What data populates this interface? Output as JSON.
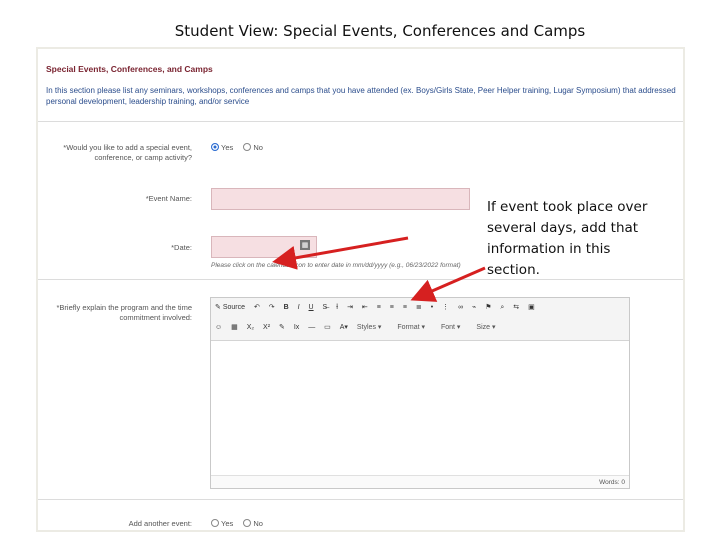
{
  "slide": {
    "title": "Student View: Special Events, Conferences and Camps",
    "annotation": "If event took place over several days, add that information in this section."
  },
  "form": {
    "section_title": "Special Events, Conferences, and Camps",
    "section_text": "In this section please list any seminars, workshops, conferences and camps that you have attended (ex. Boys/Girls State, Peer Helper training, Lugar Symposium) that addressed personal development, leadership training, and/or service",
    "add_event_label": "*Would you like to add a special event, conference, or camp activity?",
    "yes_label": "Yes",
    "no_label": "No",
    "event_name_label": "*Event Name:",
    "event_name_value": "",
    "date_label": "*Date:",
    "date_value": "",
    "date_hint": "Please click on the calendar icon to enter date in mm/dd/yyyy (e.g., 06/23/2022 format)",
    "explain_label": "*Briefly explain the program and the time commitment involved:",
    "add_another_label": "Add another event:",
    "add_another_yes": "Yes",
    "add_another_no": "No",
    "add_event_selected": "Yes"
  },
  "editor": {
    "source_label": "Source",
    "styles_label": "Styles",
    "format_label": "Format",
    "font_label": "Font",
    "size_label": "Size",
    "word_count": "Words: 0",
    "body_text": ""
  },
  "colors": {
    "section_title": "#7a2431",
    "section_text": "#2b4d8c",
    "required_input_bg": "#f6dfe2",
    "arrow": "#d62020"
  },
  "icons": [
    "undo-icon",
    "redo-icon",
    "bold-icon",
    "italic-icon",
    "underline-icon",
    "strike-icon",
    "align-left-icon",
    "align-center-icon",
    "align-right-icon",
    "justify-icon",
    "link-icon",
    "image-icon",
    "table-icon",
    "calendar-icon",
    "save-icon"
  ]
}
